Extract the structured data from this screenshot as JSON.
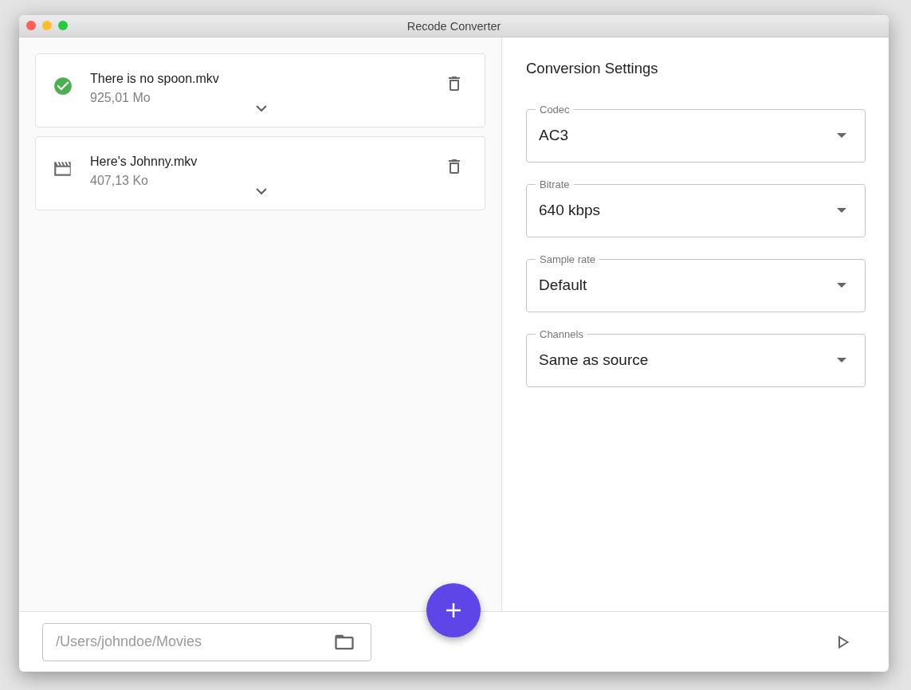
{
  "window": {
    "title": "Recode Converter"
  },
  "files": [
    {
      "name": "There is no spoon.mkv",
      "size": "925,01 Mo",
      "kind": "done"
    },
    {
      "name": "Here's Johnny.mkv",
      "size": "407,13 Ko",
      "kind": "video"
    }
  ],
  "settings": {
    "title": "Conversion Settings",
    "fields": [
      {
        "label": "Codec",
        "value": "AC3"
      },
      {
        "label": "Bitrate",
        "value": "640 kbps"
      },
      {
        "label": "Sample rate",
        "value": "Default"
      },
      {
        "label": "Channels",
        "value": "Same as source"
      }
    ]
  },
  "output": {
    "placeholder": "/Users/johndoe/Movies"
  }
}
